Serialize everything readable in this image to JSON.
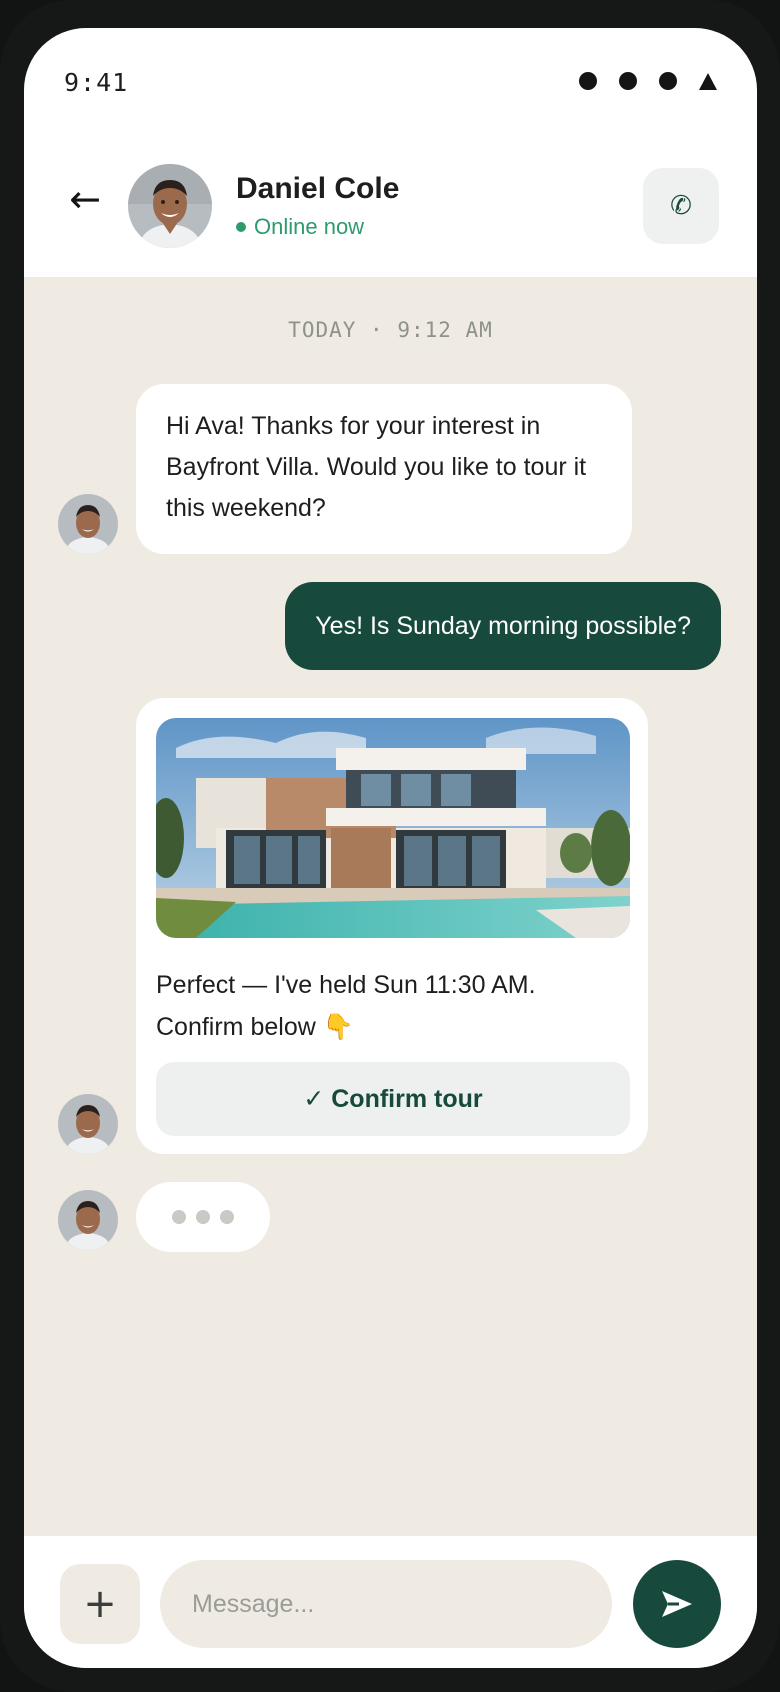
{
  "status_bar": {
    "time": "9:41"
  },
  "header": {
    "back_icon": "arrow-left-icon",
    "contact_name": "Daniel Cole",
    "contact_status": "Online now",
    "call_icon": "phone-icon",
    "call_glyph": "✆"
  },
  "chat": {
    "date_divider": "TODAY · 9:12 AM",
    "messages": [
      {
        "direction": "incoming",
        "text": "Hi Ava! Thanks for your interest in Bayfront Villa. Would you like to tour it this weekend?"
      },
      {
        "direction": "outgoing",
        "text": "Yes! Is Sunday morning possible?"
      },
      {
        "direction": "incoming",
        "type": "card",
        "image": "modern-villa-with-pool-photo",
        "text": "Perfect — I've held Sun 11:30 AM. Confirm below 👇",
        "button_label": "✓ Confirm tour"
      }
    ],
    "typing_indicator": "contact-typing"
  },
  "composer": {
    "attach_glyph": "+",
    "placeholder": "Message...",
    "send_icon": "send-icon"
  },
  "colors": {
    "accent": "#174a3c",
    "online": "#2e9b6e",
    "chat_background": "#efebe3",
    "bubble_incoming": "#ffffff"
  }
}
